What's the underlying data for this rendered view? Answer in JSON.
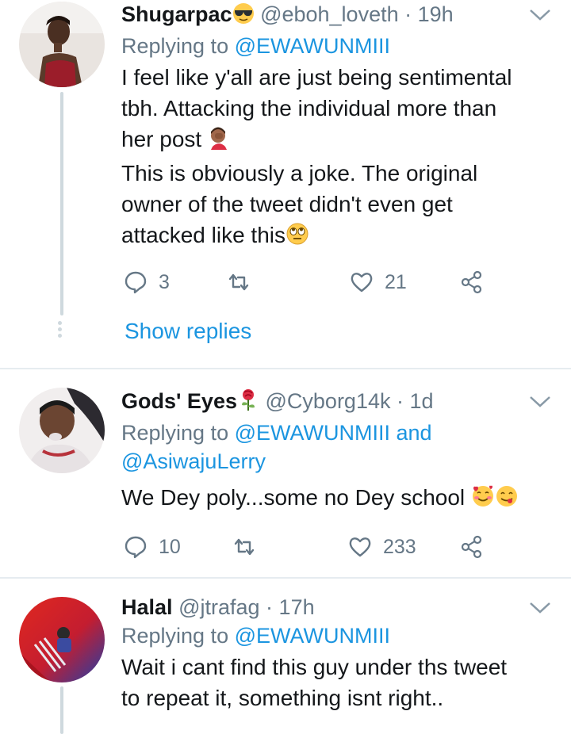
{
  "tweets": [
    {
      "name": "Shugarpac",
      "name_emoji": "sunglasses-emoji",
      "handle": "@eboh_loveth",
      "sep": "·",
      "time": "19h",
      "replying_prefix": "Replying to",
      "replying_to": "@EWAWUNMIII",
      "body_lines": [
        "I feel like y'all are just being sentimental",
        "tbh. Attacking the individual more than",
        "her post",
        "This is obviously a joke. The original",
        "owner of the tweet didn't even get",
        "attacked like this"
      ],
      "reply_count": "3",
      "retweet_count": "",
      "like_count": "21",
      "show_replies": "Show replies"
    },
    {
      "name": "Gods' Eyes",
      "name_emoji": "rose-emoji",
      "handle": "@Cyborg14k",
      "sep": "·",
      "time": "1d",
      "replying_prefix": "Replying to",
      "replying_to": "@EWAWUNMIII",
      "replying_and": "and",
      "replying_to_2": "@AsiwajuLerry",
      "body_lines": [
        "We Dey poly...some no Dey school"
      ],
      "reply_count": "10",
      "retweet_count": "",
      "like_count": "233"
    },
    {
      "name": "Halal",
      "handle": "@jtrafag",
      "sep": "·",
      "time": "17h",
      "replying_prefix": "Replying to",
      "replying_to": "@EWAWUNMIII",
      "body_lines": [
        "Wait i cant find this guy under ths tweet",
        "to repeat it, something isnt right.."
      ]
    }
  ],
  "colors": {
    "link": "#1b95e0",
    "secondary": "#657786",
    "divider": "#e6ecf0",
    "thread_line": "#cfd9de"
  }
}
